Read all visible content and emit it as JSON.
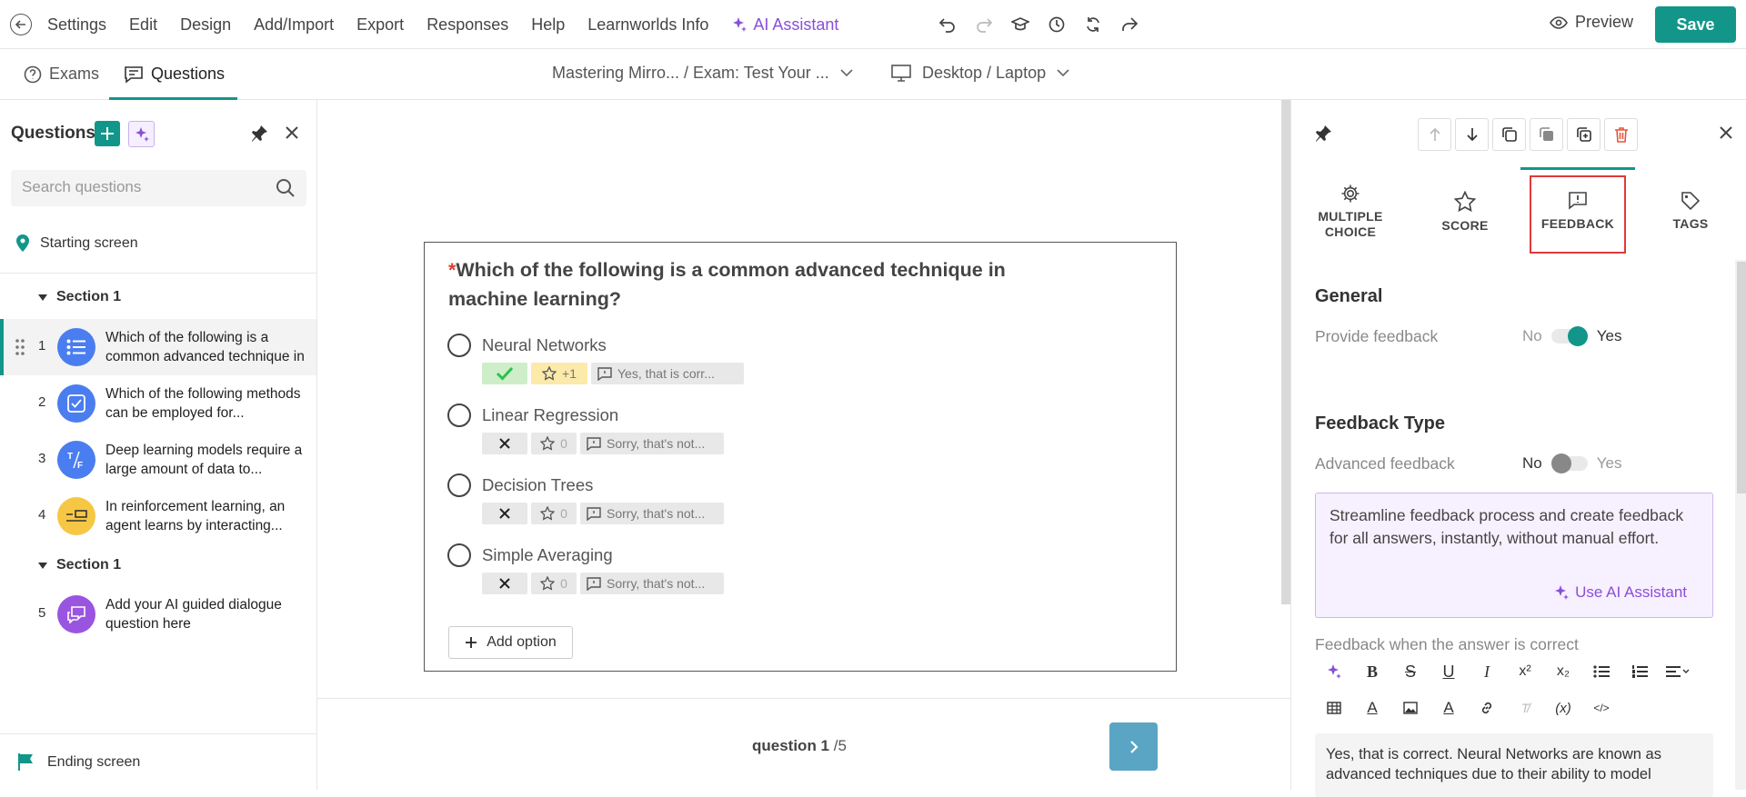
{
  "menu": {
    "items": [
      "Settings",
      "Edit",
      "Design",
      "Add/Import",
      "Export",
      "Responses",
      "Help",
      "Learnworlds Info"
    ],
    "ai_assistant": "AI Assistant",
    "preview": "Preview",
    "save": "Save"
  },
  "subbar": {
    "tabs": [
      "Exams",
      "Questions"
    ],
    "breadcrumb": "Mastering Mirro... / Exam: Test Your ...",
    "device": "Desktop / Laptop"
  },
  "left_panel": {
    "title": "Questions",
    "search_placeholder": "Search questions",
    "starting_screen": "Starting screen",
    "sections": [
      "Section 1",
      "Section 1"
    ],
    "questions": [
      {
        "num": "1",
        "text": "Which of the following is a common advanced technique in machine learning?",
        "type": "multiple-choice",
        "color": "#4a7df0"
      },
      {
        "num": "2",
        "text": "Which of the following methods can be employed for...",
        "type": "checkbox",
        "color": "#4a7df0"
      },
      {
        "num": "3",
        "text": "Deep learning models require a large amount of data to...",
        "type": "true-false",
        "color": "#4a7df0"
      },
      {
        "num": "4",
        "text": "In reinforcement learning, an agent learns by interacting...",
        "type": "fill-in",
        "color": "#f6c744"
      },
      {
        "num": "5",
        "text": "Add your AI guided dialogue question here",
        "type": "ai-dialogue",
        "color": "#9a55e0"
      }
    ],
    "ending_screen": "Ending screen"
  },
  "question": {
    "required_mark": "*",
    "title": "Which of the following is a common advanced technique in machine learning?",
    "options": [
      {
        "label": "Neural Networks",
        "correct": true,
        "score": "+1",
        "feedback": "Yes, that is corr..."
      },
      {
        "label": "Linear Regression",
        "correct": false,
        "score": "0",
        "feedback": "Sorry, that's not..."
      },
      {
        "label": "Decision Trees",
        "correct": false,
        "score": "0",
        "feedback": "Sorry, that's not..."
      },
      {
        "label": "Simple Averaging",
        "correct": false,
        "score": "0",
        "feedback": "Sorry, that's not..."
      }
    ],
    "add_option": "Add option",
    "pager_current": "question 1",
    "pager_total": "/5"
  },
  "right_panel": {
    "tabs": [
      "MULTIPLE CHOICE",
      "SCORE",
      "FEEDBACK",
      "TAGS"
    ],
    "active_tab": "FEEDBACK",
    "general_heading": "General",
    "provide_feedback_label": "Provide feedback",
    "provide_feedback": {
      "no": "No",
      "yes": "Yes",
      "value": true
    },
    "feedback_type_heading": "Feedback Type",
    "advanced_feedback_label": "Advanced feedback",
    "advanced_feedback": {
      "no": "No",
      "yes": "Yes",
      "value": false
    },
    "ai_box_text": "Streamline feedback process and create feedback for all answers, instantly, without manual effort.",
    "use_ai": "Use AI Assistant",
    "correct_feedback_label": "Feedback when the answer is correct",
    "correct_feedback_text": "Yes, that is correct. Neural Networks are known as advanced techniques due to their ability to model"
  },
  "colors": {
    "accent": "#12968a",
    "ai_purple": "#8a4fd8",
    "highlight_red": "#e03a3a"
  }
}
